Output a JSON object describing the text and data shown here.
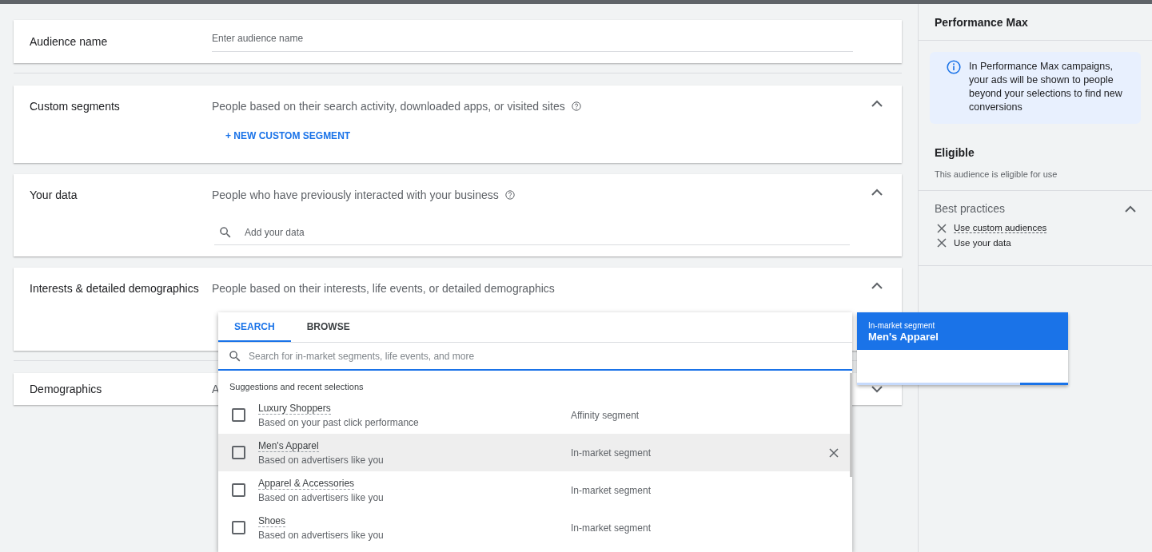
{
  "audience_name": {
    "label": "Audience name",
    "placeholder": "Enter audience name"
  },
  "sections": [
    {
      "kind": "link",
      "title": "Custom segments",
      "description": "People based on their search activity, downloaded apps, or visited sites",
      "help": true,
      "expanded": true,
      "action": "+ NEW CUSTOM SEGMENT"
    },
    {
      "kind": "search",
      "title": "Your data",
      "description": "People who have previously interacted with your business",
      "help": true,
      "expanded": true,
      "placeholder": "Add your data"
    },
    {
      "kind": "plain",
      "title": "Interests & detailed demographics",
      "description": "People based on their interests, life events, or detailed demographics",
      "help": false,
      "expanded": true
    },
    {
      "kind": "plain",
      "title": "Demographics",
      "description": "A",
      "help": false,
      "expanded": false
    }
  ],
  "picker": {
    "tabs": [
      {
        "label": "SEARCH",
        "selected": true
      },
      {
        "label": "BROWSE",
        "selected": false
      }
    ],
    "search_placeholder": "Search for in-market segments, life events, and more",
    "section_label": "Suggestions and recent selections",
    "rows": [
      {
        "name": "Luxury Shoppers",
        "note": "Based on your past click performance",
        "type": "Affinity segment",
        "checked": false,
        "hovered": false
      },
      {
        "name": "Men's Apparel",
        "note": "Based on advertisers like you",
        "type": "In-market segment",
        "checked": false,
        "hovered": true
      },
      {
        "name": "Apparel & Accessories",
        "note": "Based on advertisers like you",
        "type": "In-market segment",
        "checked": false,
        "hovered": false
      },
      {
        "name": "Shoes",
        "note": "Based on advertisers like you",
        "type": "In-market segment",
        "checked": false,
        "hovered": false
      }
    ]
  },
  "tooltip": {
    "type": "In-market segment",
    "name": "Men's Apparel"
  },
  "side": {
    "title": "Performance Max",
    "info": "In Performance Max campaigns, your ads will be shown to people beyond your selections to find new conversions",
    "status": "Eligible",
    "status_note": "This audience is eligible for use",
    "practices": {
      "title": "Best practices",
      "expanded": true,
      "items": [
        {
          "label": "Use custom audiences",
          "link": true
        },
        {
          "label": "Use your data",
          "link": false
        }
      ]
    }
  }
}
